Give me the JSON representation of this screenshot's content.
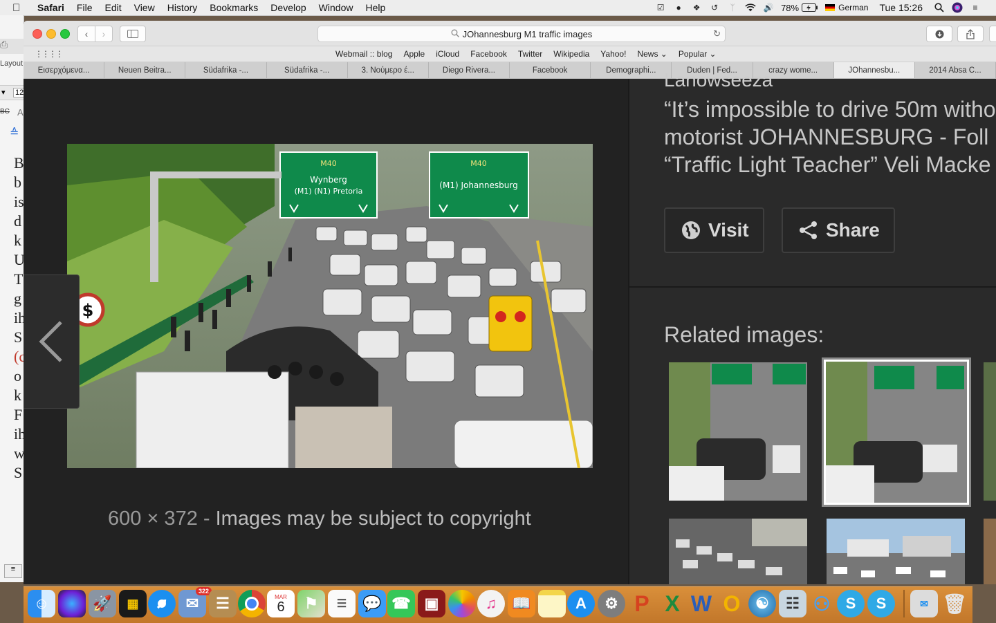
{
  "menubar": {
    "app": "Safari",
    "items": [
      "File",
      "Edit",
      "View",
      "History",
      "Bookmarks",
      "Develop",
      "Window",
      "Help"
    ],
    "battery": "78%",
    "language": "German",
    "clock": "Tue 15:26"
  },
  "background_app": {
    "label_layout": "Layout",
    "font_size": "12",
    "abc": "BC",
    "text_letters": [
      "B",
      "b",
      "is",
      "d",
      "k",
      "U",
      "T",
      "g",
      "ih",
      "S",
      "(c",
      "o",
      "k",
      "F",
      "ih",
      "w",
      "S"
    ]
  },
  "browser": {
    "url": "JOhannesburg M1 traffic images",
    "favorites": [
      "Webmail :: blog",
      "Apple",
      "iCloud",
      "Facebook",
      "Twitter",
      "Wikipedia",
      "Yahoo!",
      "News ⌄",
      "Popular ⌄"
    ],
    "tabs": [
      "Εισερχόμενα...",
      "Neuen Beitra...",
      "Südafrika -...",
      "Südafrika -...",
      "3. Νούμερο έ...",
      "Diego Rivera...",
      "Facebook",
      "Demographi...",
      "Duden | Fed...",
      "crazy wome...",
      "JOhannesbu...",
      "2014 Absa C..."
    ],
    "active_tab_index": 10
  },
  "viewer": {
    "sign_left": {
      "route": "M40",
      "line1": "Wynberg",
      "line2": "(M1) (N1) Pretoria"
    },
    "sign_right": {
      "route": "M40",
      "line1": "(M1) Johannesburg"
    },
    "dimensions": "600 × 372",
    "dash": "-",
    "copyright": "Images may be subject to copyright",
    "site_cut": "Lanowseeza",
    "title_lines": [
      "“It’s impossible to drive 50m witho",
      "motorist JOHANNESBURG - Foll",
      "“Traffic Light Teacher” Veli Macke"
    ],
    "visit_label": "Visit",
    "share_label": "Share",
    "related_label": "Related images:"
  },
  "dock": {
    "calendar_month": "MAR",
    "calendar_day": "6",
    "badge_count": "322"
  }
}
